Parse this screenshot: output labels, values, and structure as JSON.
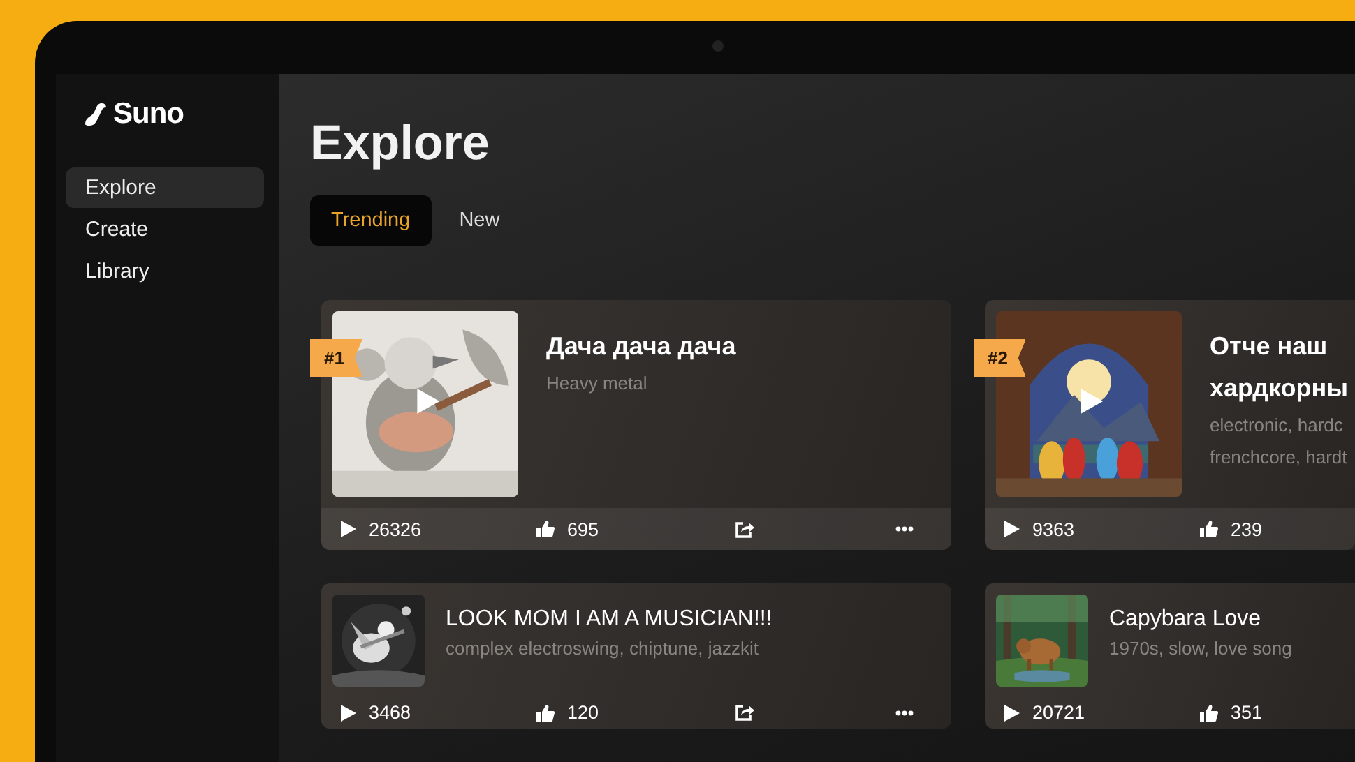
{
  "app": {
    "logo": "Suno"
  },
  "sidebar": {
    "items": [
      {
        "label": "Explore",
        "selected": true
      },
      {
        "label": "Create",
        "selected": false
      },
      {
        "label": "Library",
        "selected": false
      }
    ]
  },
  "page": {
    "title": "Explore"
  },
  "tabs": [
    {
      "label": "Trending",
      "selected": true
    },
    {
      "label": "New",
      "selected": false
    }
  ],
  "songs": [
    {
      "kind": "featured",
      "rank": "#1",
      "title": "Дача дача дача",
      "tags": "Heavy metal",
      "plays": "26326",
      "likes": "695"
    },
    {
      "kind": "featured",
      "rank": "#2",
      "title": "Отче наш\nхардкорны",
      "tags": "electronic, hardc\nfrenchcore, hardt",
      "plays": "9363",
      "likes": "239"
    },
    {
      "kind": "compact",
      "title": "LOOK MOM I AM A MUSICIAN!!!",
      "tags": "complex electroswing, chiptune, jazzkit",
      "plays": "3468",
      "likes": "120"
    },
    {
      "kind": "compact",
      "title": "Capybara Love",
      "tags": "1970s, slow, love song",
      "plays": "20721",
      "likes": "351"
    }
  ]
}
